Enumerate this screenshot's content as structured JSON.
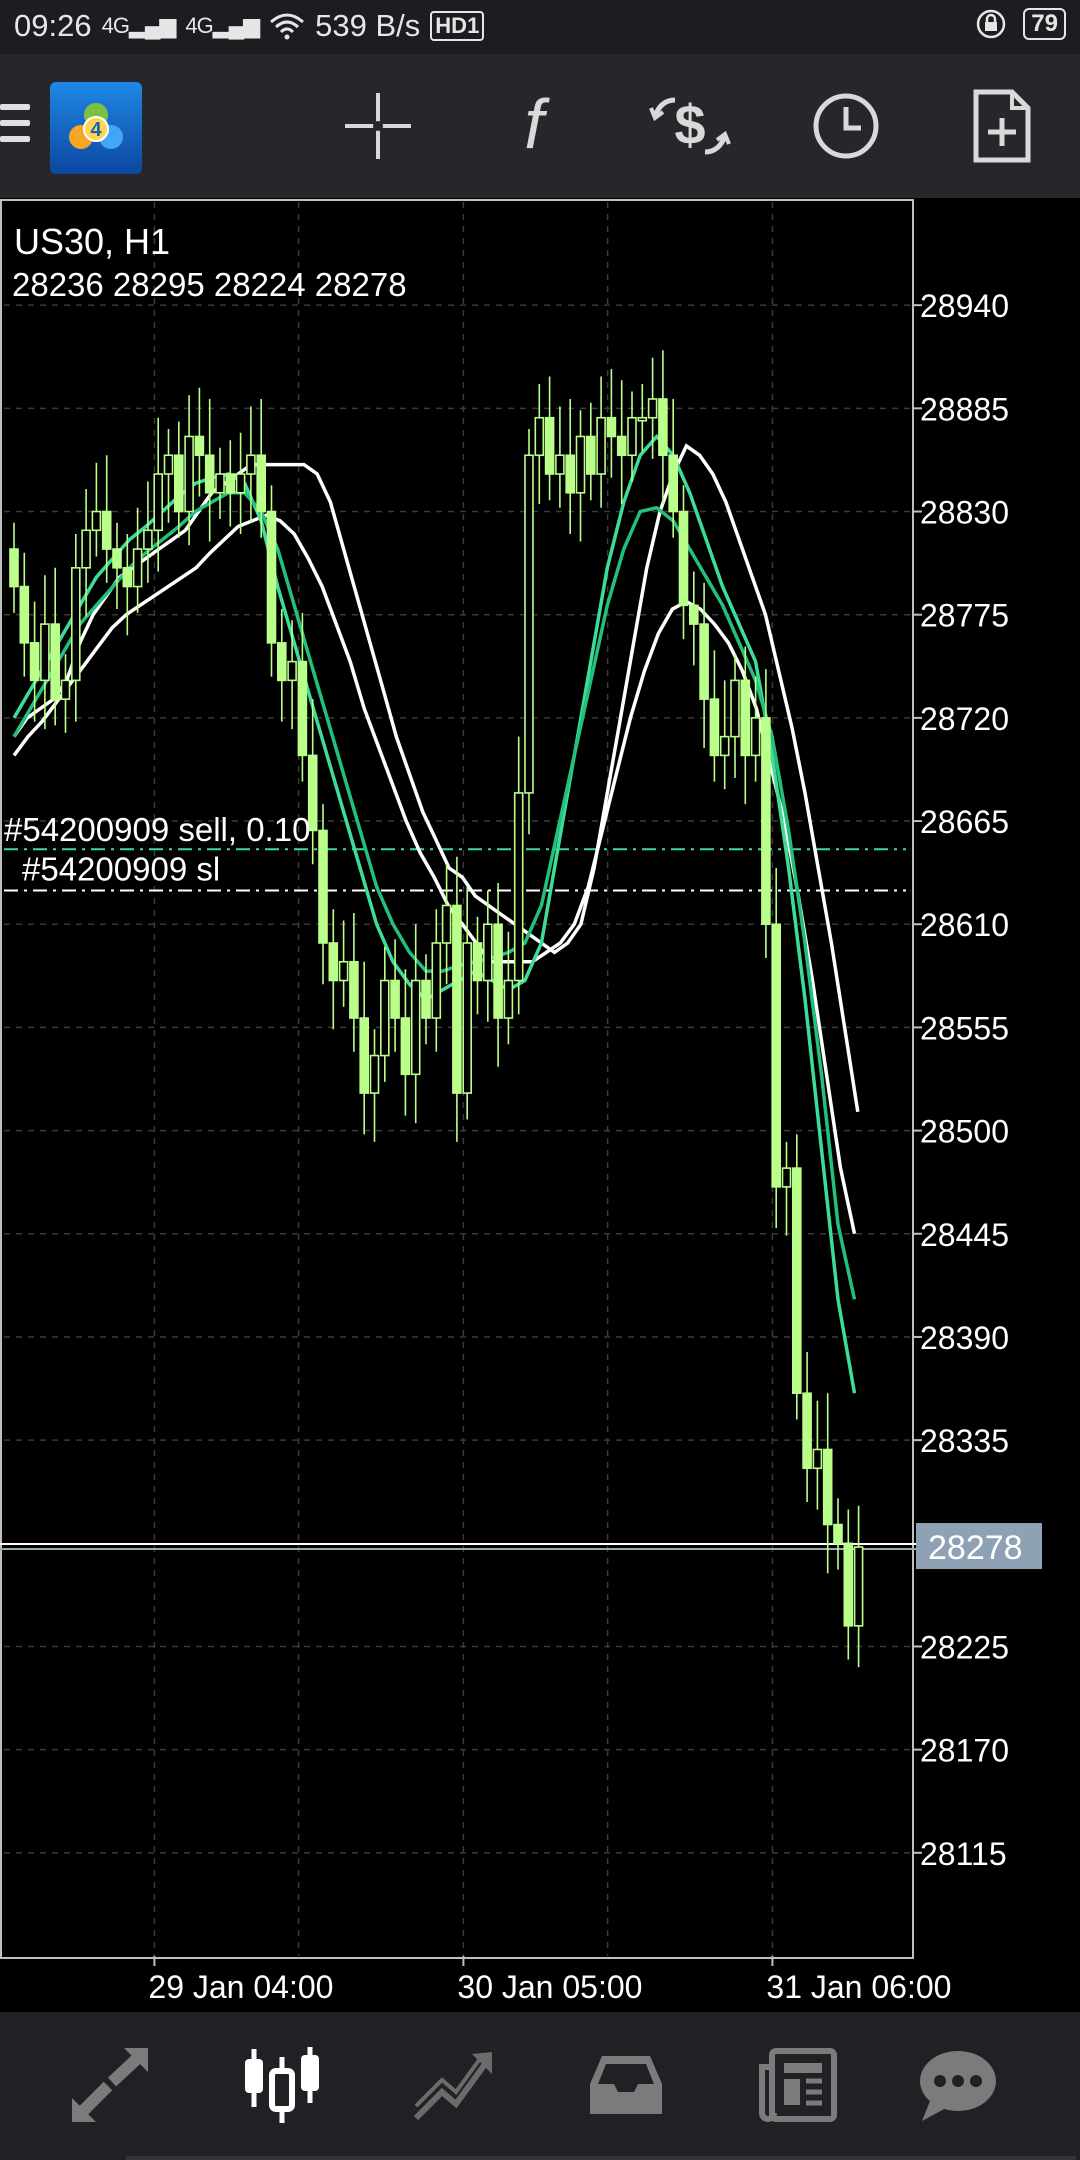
{
  "status_bar": {
    "time": "09:26",
    "net1": "4G",
    "net2": "4G",
    "speed": "539 B/s",
    "hd": "HD1",
    "battery": "79"
  },
  "toolbar": {
    "icons": [
      "menu-icon",
      "metatrader-logo",
      "crosshair-icon",
      "indicators-f-icon",
      "trade-dollar-icon",
      "clock-timeframe-icon",
      "new-order-document-icon"
    ]
  },
  "chart": {
    "symbol_title": "US30, H1",
    "ohlc": "28236 28295 28224 28278",
    "order_label": "#54200909 sell, 0.10",
    "sl_label": "#54200909 sl",
    "current_price_label": "28278",
    "colors": {
      "candle": "#baff8a",
      "ma1": "#ffffff",
      "ma2": "#3ddc97",
      "order_line": "#3ddc97",
      "price_tag": "#8fa2b5"
    }
  },
  "chart_data": {
    "type": "candlestick",
    "symbol": "US30",
    "timeframe": "H1",
    "ylim": [
      28060,
      28995
    ],
    "y_ticks": [
      28940,
      28885,
      28830,
      28775,
      28720,
      28665,
      28610,
      28555,
      28500,
      28445,
      28390,
      28335,
      28225,
      28170,
      28115
    ],
    "x_tick_labels": [
      "29 Jan 04:00",
      "30 Jan 05:00",
      "31 Jan 06:00"
    ],
    "x_tick_bars": [
      8,
      38,
      68
    ],
    "current_price": 28278,
    "order_price": 28650,
    "sl_price": 28628,
    "close": [
      28790,
      28760,
      28740,
      28770,
      28730,
      28740,
      28800,
      28820,
      28830,
      28810,
      28800,
      28790,
      28810,
      28820,
      28850,
      28860,
      28830,
      28870,
      28860,
      28840,
      28850,
      28840,
      28850,
      28860,
      28830,
      28760,
      28740,
      28750,
      28700,
      28660,
      28600,
      28580,
      28590,
      28560,
      28520,
      28540,
      28580,
      28560,
      28530,
      28580,
      28560,
      28600,
      28620,
      28520,
      28600,
      28580,
      28610,
      28560,
      28580,
      28680,
      28860,
      28880,
      28850,
      28860,
      28840,
      28870,
      28850,
      28880,
      28870,
      28860,
      28880,
      28880,
      28890,
      28860,
      28830,
      28780,
      28770,
      28730,
      28700,
      28710,
      28740,
      28700,
      28720,
      28610,
      28470,
      28480,
      28360,
      28320,
      28330,
      28290,
      28280,
      28236,
      28278
    ],
    "ma_white_fast": [
      28710,
      28720,
      28725,
      28730,
      28740,
      28760,
      28775,
      28785,
      28795,
      28800,
      28805,
      28810,
      28815,
      28820,
      28830,
      28840,
      28845,
      28850,
      28855,
      28855,
      28855,
      28855,
      28855,
      28850,
      28835,
      28810,
      28785,
      28760,
      28735,
      28710,
      28690,
      28670,
      28655,
      28640,
      28635,
      28625,
      28620,
      28615,
      28610,
      28605,
      28600,
      28595,
      28600,
      28610,
      28640,
      28680,
      28720,
      28760,
      28800,
      28830,
      28850,
      28865,
      28860,
      28850,
      28835,
      28815,
      28795,
      28775,
      28745,
      28715,
      28680,
      28640,
      28600,
      28555,
      28510
    ],
    "ma_white_slow": [
      28700,
      28710,
      28718,
      28728,
      28738,
      28748,
      28758,
      28768,
      28775,
      28780,
      28785,
      28790,
      28795,
      28800,
      28808,
      28815,
      28822,
      28825,
      28828,
      28825,
      28818,
      28805,
      28790,
      28770,
      28750,
      28725,
      28705,
      28685,
      28665,
      28648,
      28635,
      28620,
      28610,
      28600,
      28590,
      28590,
      28590,
      28590,
      28595,
      28600,
      28610,
      28630,
      28660,
      28690,
      28720,
      28745,
      28765,
      28778,
      28782,
      28778,
      28770,
      28760,
      28745,
      28725,
      28695,
      28665,
      28625,
      28580,
      28530,
      28480,
      28445
    ],
    "ma_green_fast": [
      28720,
      28735,
      28750,
      28765,
      28780,
      28795,
      28805,
      28815,
      28822,
      28830,
      28838,
      28845,
      28848,
      28850,
      28845,
      28825,
      28790,
      28760,
      28730,
      28700,
      28670,
      28640,
      28610,
      28590,
      28578,
      28570,
      28575,
      28580,
      28585,
      28580,
      28575,
      28580,
      28600,
      28650,
      28700,
      28750,
      28800,
      28835,
      28860,
      28870,
      28860,
      28840,
      28815,
      28790,
      28770,
      28750,
      28700,
      28640,
      28570,
      28490,
      28410,
      28360
    ],
    "ma_green_slow": [
      28710,
      28725,
      28740,
      28755,
      28770,
      28780,
      28790,
      28800,
      28808,
      28815,
      28822,
      28830,
      28835,
      28840,
      28840,
      28830,
      28810,
      28780,
      28750,
      28720,
      28690,
      28660,
      28630,
      28610,
      28595,
      28585,
      28585,
      28588,
      28590,
      28592,
      28595,
      28600,
      28620,
      28660,
      28700,
      28740,
      28780,
      28810,
      28830,
      28832,
      28825,
      28810,
      28795,
      28780,
      28760,
      28740,
      28710,
      28660,
      28600,
      28530,
      28450,
      28410
    ]
  },
  "bottom_nav": {
    "icons": [
      "quotes-arrows-icon",
      "chart-candles-icon",
      "trade-line-icon",
      "history-inbox-icon",
      "news-icon",
      "chat-bubble-icon"
    ],
    "active": "chart-candles-icon"
  }
}
